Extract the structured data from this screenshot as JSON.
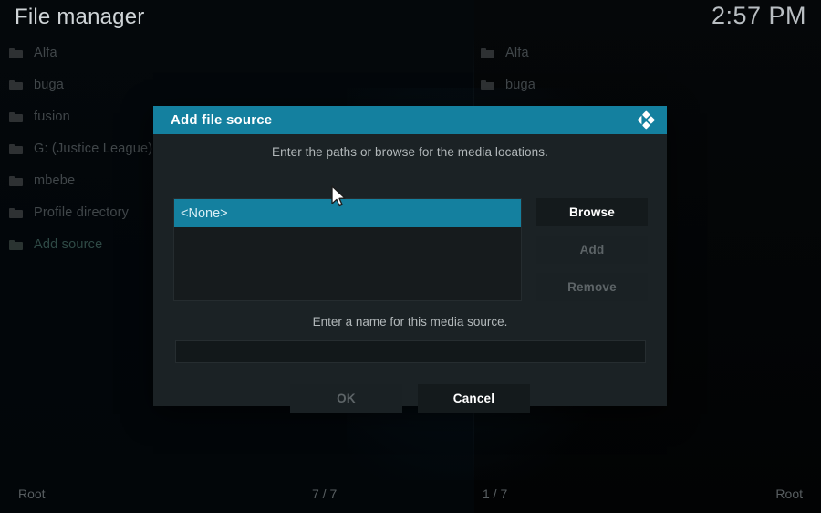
{
  "header": {
    "title": "File manager",
    "clock": "2:57 PM"
  },
  "colors": {
    "accent_teal": "#14809f",
    "dialog_bg": "#1b2225",
    "list_bg": "#161b1d",
    "text_dim": "#41474a"
  },
  "left_pane": {
    "items": [
      {
        "label": "Alfa",
        "icon": "folder-icon",
        "accent": false
      },
      {
        "label": "buga",
        "icon": "folder-icon",
        "accent": false
      },
      {
        "label": "fusion",
        "icon": "folder-icon",
        "accent": false
      },
      {
        "label": "G: (Justice League)",
        "icon": "folder-icon",
        "accent": false
      },
      {
        "label": "mbebe",
        "icon": "folder-icon",
        "accent": false
      },
      {
        "label": "Profile directory",
        "icon": "folder-icon",
        "accent": false
      },
      {
        "label": "Add source",
        "icon": "folder-icon",
        "accent": true
      }
    ]
  },
  "right_pane": {
    "items": [
      {
        "label": "Alfa",
        "icon": "folder-icon",
        "accent": false
      },
      {
        "label": "buga",
        "icon": "folder-icon",
        "accent": false
      }
    ]
  },
  "statusbar": {
    "left_path": "Root",
    "left_count": "7 / 7",
    "right_count": "1 / 7",
    "right_path": "Root"
  },
  "dialog": {
    "title": "Add file source",
    "logo_icon": "kodi-logo-icon",
    "hint_paths": "Enter the paths or browse for the media locations.",
    "path_items": [
      {
        "label": "<None>",
        "selected": true
      }
    ],
    "side_buttons": [
      {
        "label": "Browse",
        "enabled": true
      },
      {
        "label": "Add",
        "enabled": false
      },
      {
        "label": "Remove",
        "enabled": false
      }
    ],
    "hint_name": "Enter a name for this media source.",
    "name_input": {
      "value": "",
      "placeholder": ""
    },
    "footer_buttons": [
      {
        "label": "OK",
        "enabled": false
      },
      {
        "label": "Cancel",
        "enabled": true
      }
    ]
  },
  "cursor": {
    "icon": "mouse-pointer-icon"
  }
}
